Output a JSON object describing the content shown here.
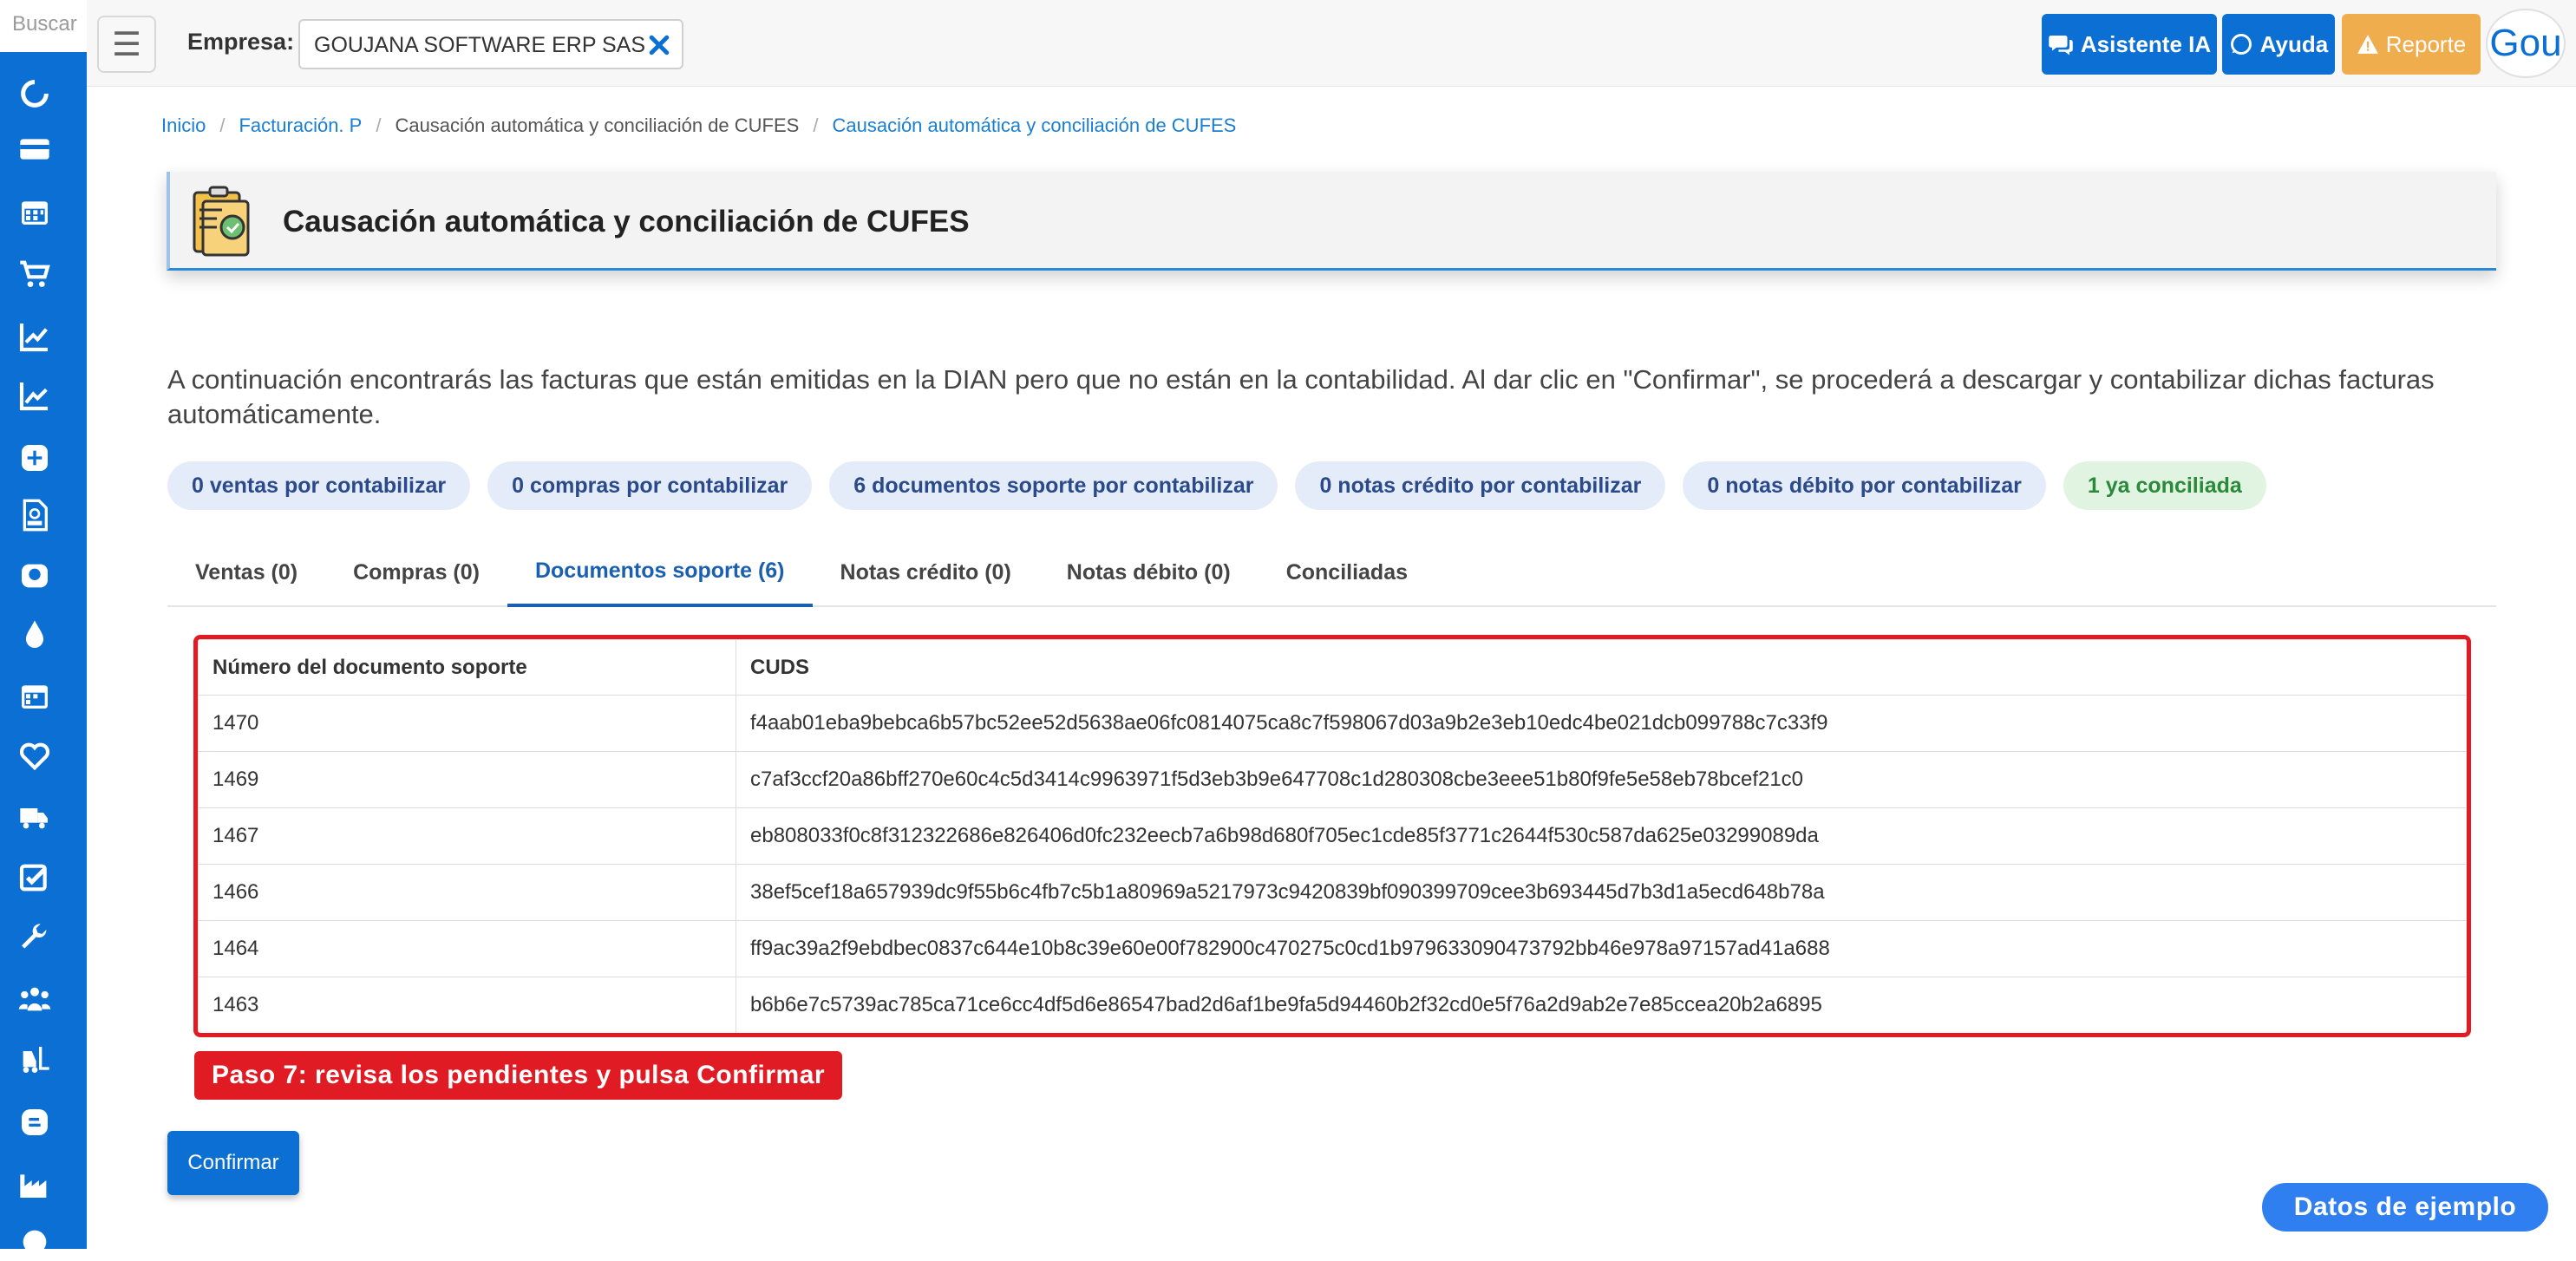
{
  "sidebar": {
    "search_placeholder": "Buscar",
    "icons": [
      "refresh-icon",
      "credit-card-icon",
      "calendar-icon",
      "cart-icon",
      "chart-line-icon",
      "chart-area-icon",
      "plus-square-icon",
      "rips-file-icon",
      "wallet-icon",
      "water-drop-icon",
      "calendar-grid-icon",
      "heart-icon",
      "truck-icon",
      "checklist-icon",
      "wrench-icon",
      "users-icon",
      "forklift-icon",
      "blog-icon",
      "industry-icon",
      "support-icon"
    ]
  },
  "topbar": {
    "empresa_label": "Empresa:",
    "empresa_value": "GOUJANA SOFTWARE ERP SAS",
    "asistente_label": "Asistente IA",
    "ayuda_label": "Ayuda",
    "reporte_label": "Reporte",
    "avatar_text": "Gou"
  },
  "breadcrumb": {
    "inicio": "Inicio",
    "facturacion": "Facturación. P",
    "parent": "Causación automática y conciliación de CUFES",
    "current": "Causación automática y conciliación de CUFES"
  },
  "page": {
    "title": "Causación automática y conciliación de CUFES",
    "description": "A continuación encontrarás las facturas que están emitidas en la DIAN pero que no están en la contabilidad. Al dar clic en \"Confirmar\", se procederá a descargar y contabilizar dichas facturas automáticamente."
  },
  "badges": [
    "0 ventas por contabilizar",
    "0 compras por contabilizar",
    "6 documentos soporte por contabilizar",
    "0 notas crédito por contabilizar",
    "0 notas débito por contabilizar",
    "1 ya conciliada"
  ],
  "tabs": [
    "Ventas (0)",
    "Compras (0)",
    "Documentos soporte (6)",
    "Notas crédito (0)",
    "Notas débito (0)",
    "Conciliadas"
  ],
  "table": {
    "headers": [
      "Número del documento soporte",
      "CUDS"
    ],
    "rows": [
      [
        "1470",
        "f4aab01eba9bebca6b57bc52ee52d5638ae06fc0814075ca8c7f598067d03a9b2e3eb10edc4be021dcb099788c7c33f9"
      ],
      [
        "1469",
        "c7af3ccf20a86bff270e60c4c5d3414c9963971f5d3eb3b9e647708c1d280308cbe3eee51b80f9fe5e58eb78bcef21c0"
      ],
      [
        "1467",
        "eb808033f0c8f312322686e826406d0fc232eecb7a6b98d680f705ec1cde85f3771c2644f530c587da625e03299089da"
      ],
      [
        "1466",
        "38ef5cef18a657939dc9f55b6c4fb7c5b1a80969a5217973c9420839bf090399709cee3b693445d7b3d1a5ecd648b78a"
      ],
      [
        "1464",
        "ff9ac39a2f9ebdbec0837c644e10b8c39e60e00f782900c470275c0cd1b979633090473792bb46e978a97157ad41a688"
      ],
      [
        "1463",
        "b6b6e7c5739ac785ca71ce6cc4df5d6e86547bad2d6af1be9fa5d94460b2f32cd0e5f76a2d9ab2e7e85ccea20b2a6895"
      ]
    ]
  },
  "step_label": "Paso 7: revisa los pendientes y pulsa Confirmar",
  "confirm_label": "Confirmar",
  "sample_label": "Datos de ejemplo",
  "colors": {
    "primary": "#0b6fd4",
    "warning": "#f0ad4e",
    "highlight": "#e01b24"
  }
}
